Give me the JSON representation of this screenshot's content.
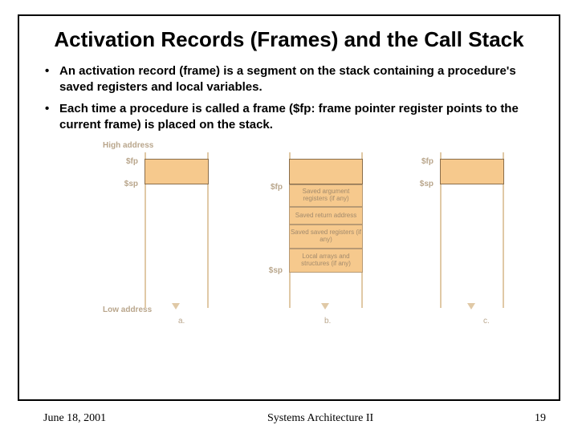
{
  "title": "Activation Records (Frames) and the Call Stack",
  "bullets": [
    "An activation record (frame) is a segment on the stack containing a procedure's saved registers and local variables.",
    "Each time a procedure is called a frame ($fp: frame pointer register points to the current frame) is placed on the stack."
  ],
  "diagram": {
    "high": "High address",
    "low": "Low address",
    "fp": "$fp",
    "sp": "$sp",
    "col_a": "a.",
    "col_b": "b.",
    "col_c": "c.",
    "seg1": "Saved argument registers (if any)",
    "seg2": "Saved return address",
    "seg3": "Saved saved registers (if any)",
    "seg4": "Local arrays and structures (if any)"
  },
  "footer": {
    "date": "June 18, 2001",
    "course": "Systems Architecture II",
    "page": "19"
  }
}
